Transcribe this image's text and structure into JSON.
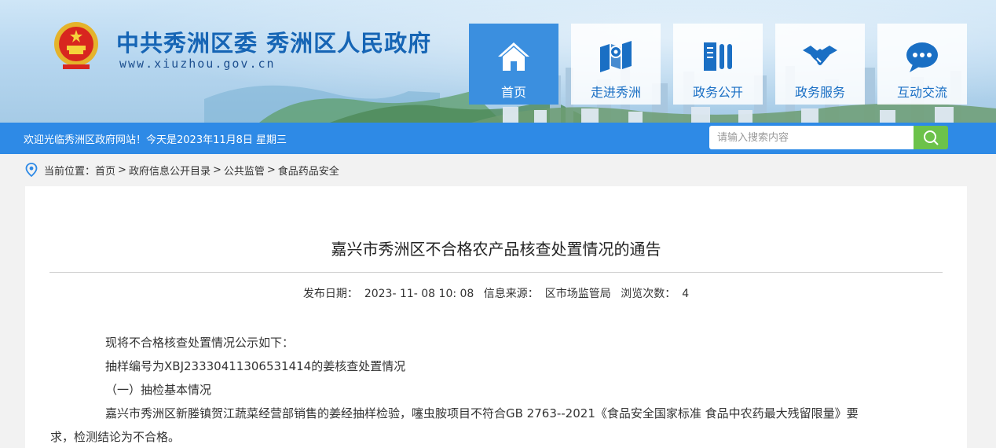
{
  "header": {
    "site_title": "中共秀洲区委 秀洲区人民政府",
    "site_url": "www.xiuzhou.gov.cn"
  },
  "nav": [
    {
      "label": "首页",
      "icon": "home-icon",
      "active": true
    },
    {
      "label": "走进秀洲",
      "icon": "map-icon",
      "active": false
    },
    {
      "label": "政务公开",
      "icon": "documents-icon",
      "active": false
    },
    {
      "label": "政务服务",
      "icon": "handshake-icon",
      "active": false
    },
    {
      "label": "互动交流",
      "icon": "chat-icon",
      "active": false
    }
  ],
  "bar": {
    "welcome": "欢迎光临秀洲区政府网站！今天是2023年11月8日 星期三",
    "search_placeholder": "请输入搜索内容"
  },
  "breadcrumb": {
    "prefix": "当前位置：",
    "items": [
      "首页",
      "政府信息公开目录",
      "公共监管",
      "食品药品安全"
    ]
  },
  "article": {
    "title": "嘉兴市秀洲区不合格农产品核查处置情况的通告",
    "meta": {
      "date_label": "发布日期：",
      "date": "2023- 11- 08 10: 08",
      "source_label": "信息来源：",
      "source": "区市场监管局",
      "views_label": "浏览次数：",
      "views": "4"
    },
    "paragraphs": [
      "现将不合格核查处置情况公示如下：",
      "抽样编号为XBJ23330411306531414的姜核查处置情况",
      "（一）抽检基本情况",
      "嘉兴市秀洲区新塍镇贺江蔬菜经营部销售的姜经抽样检验，噻虫胺项目不符合GB 2763--2021《食品安全国家标准 食品中农药最大残留限量》要",
      "求，检测结论为不合格。"
    ]
  },
  "colors": {
    "brand_blue": "#2e8ae6",
    "title_blue": "#1665b5",
    "search_green": "#6cc24a"
  }
}
